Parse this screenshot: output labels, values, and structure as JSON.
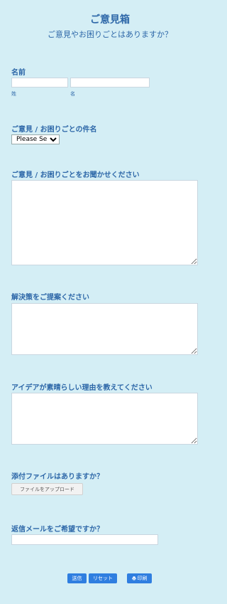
{
  "form": {
    "title": "ご意見箱",
    "subtitle": "ご意見やお困りごとはありますか？"
  },
  "name_field": {
    "label": "名前",
    "last_label": "姓",
    "first_label": "名",
    "last_value": "",
    "first_value": ""
  },
  "subject_field": {
    "label": "ご意見 / お困りごとの件名",
    "selected": "Please Select"
  },
  "detail_field": {
    "label": "ご意見 / お困りごとをお聞かせください",
    "value": ""
  },
  "solution_field": {
    "label": "解決策をご提案ください",
    "value": ""
  },
  "reason_field": {
    "label": "アイデアが素晴らしい理由を教えてください",
    "value": ""
  },
  "attachment_field": {
    "label": "添付ファイルはありますか？",
    "button_label": "ファイルをアップロード"
  },
  "reply_field": {
    "label": "返信メールをご希望ですか？",
    "value": ""
  },
  "actions": {
    "submit_label": "送信",
    "reset_label": "リセット",
    "print_label": "印刷"
  },
  "colors": {
    "background": "#d4eef5",
    "text": "#2d67a8",
    "button": "#2f7ee0"
  },
  "icons": {
    "print": "printer-icon"
  }
}
